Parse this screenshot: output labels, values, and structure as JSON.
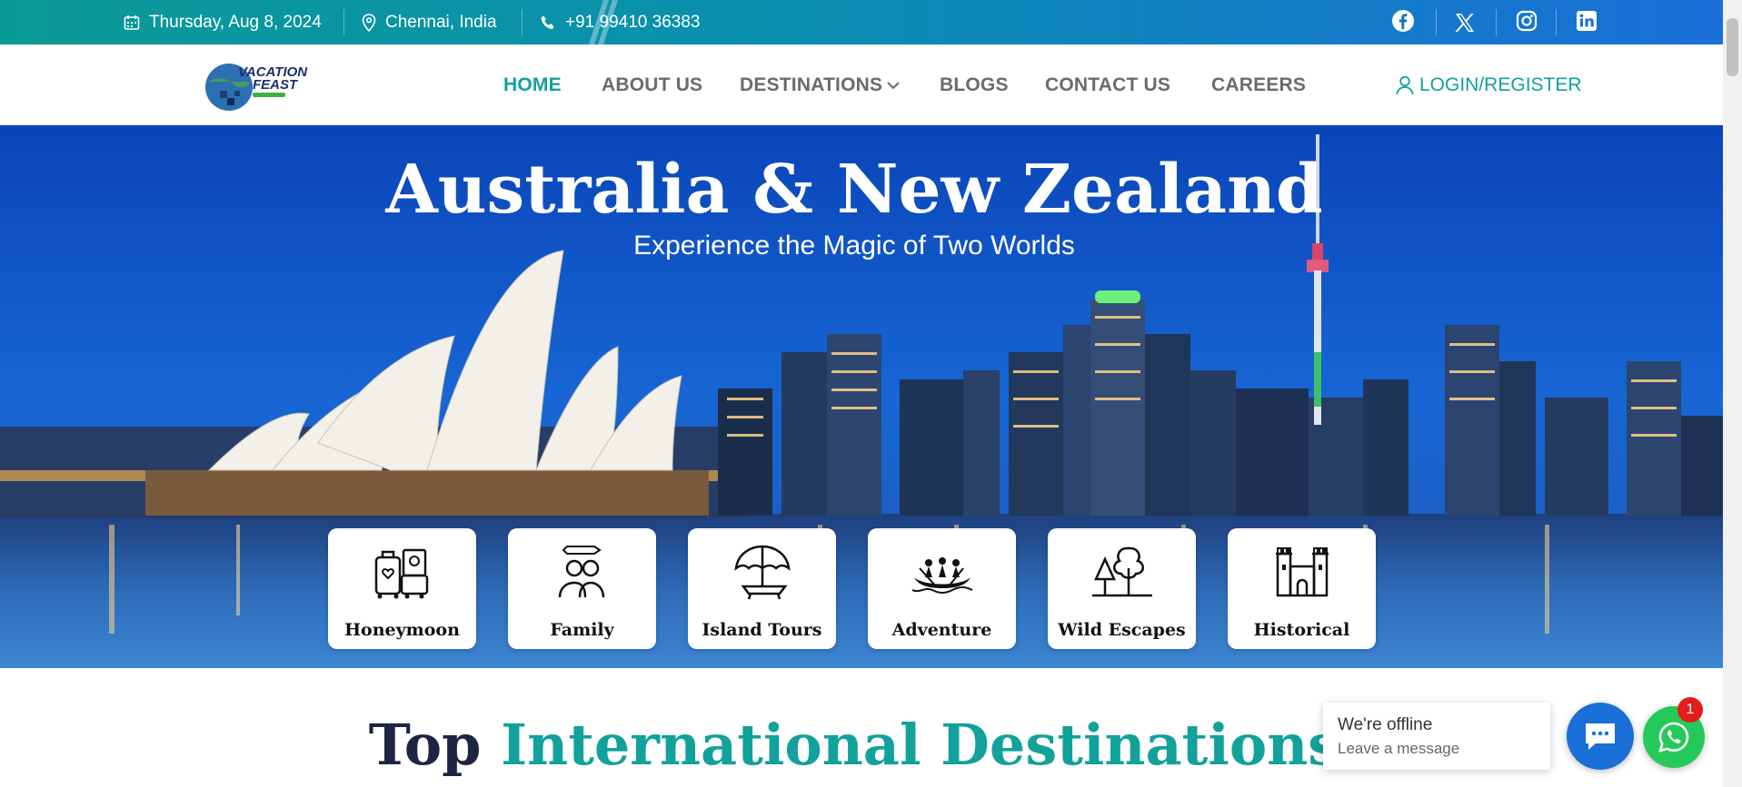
{
  "topbar": {
    "date": "Thursday, Aug 8, 2024",
    "location": "Chennai, India",
    "phone": "+91 99410 36383",
    "social": [
      "facebook-icon",
      "x-icon",
      "instagram-icon",
      "linkedin-icon"
    ]
  },
  "logo": {
    "line1": "VACATION",
    "line2": "FEAST"
  },
  "nav": {
    "items": [
      "HOME",
      "ABOUT US",
      "DESTINATIONS",
      "BLOGS",
      "CONTACT US",
      "CAREERS"
    ],
    "active": "HOME",
    "login": "LOGIN/REGISTER"
  },
  "hero": {
    "title": "Australia & New Zealand",
    "subtitle": "Experience the Magic of Two Worlds"
  },
  "categories": [
    {
      "label": "Honeymoon",
      "icon": "luggage-icon"
    },
    {
      "label": "Family",
      "icon": "family-icon"
    },
    {
      "label": "Island Tours",
      "icon": "beach-umbrella-icon"
    },
    {
      "label": "Adventure",
      "icon": "rafting-icon"
    },
    {
      "label": "Wild Escapes",
      "icon": "trees-icon"
    },
    {
      "label": "Historical",
      "icon": "castle-icon"
    }
  ],
  "section": {
    "title_a": "Top",
    "title_b": "International Destinations"
  },
  "chat": {
    "status": "We're offline",
    "prompt": "Leave a message",
    "whatsapp_badge": "1"
  },
  "colors": {
    "accent": "#12a19b",
    "brand_blue": "#1a6fd8",
    "whatsapp": "#25c95a"
  }
}
